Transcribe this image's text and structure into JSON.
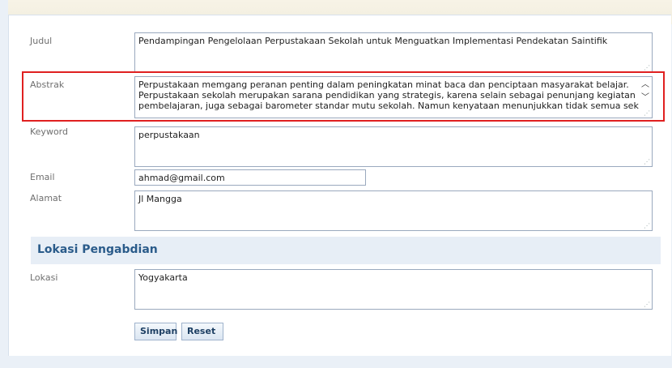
{
  "form": {
    "judul": {
      "label": "Judul",
      "value": "Pendampingan Pengelolaan Perpustakaan Sekolah untuk Menguatkan Implementasi Pendekatan Saintifik"
    },
    "abstrak": {
      "label": "Abstrak",
      "line1": "Perpustakaan memgang peranan penting dalam peningkatan minat baca dan penciptaan masyarakat belajar.",
      "line2": "Perpustakaan sekolah merupakan sarana pendidikan yang strategis, karena selain sebagai penunjang kegiatan",
      "line3": "pembelajaran, juga sebagai barometer standar mutu sekolah. Namun kenyataan menunjukkan tidak semua sekolah,"
    },
    "keyword": {
      "label": "Keyword",
      "value": "perpustakaan"
    },
    "email": {
      "label": "Email",
      "value": "ahmad@gmail.com"
    },
    "alamat": {
      "label": "Alamat",
      "value": "Jl Mangga"
    }
  },
  "lokasi_section": {
    "title": "Lokasi Pengabdian",
    "lokasi": {
      "label": "Lokasi",
      "value": "Yogyakarta"
    }
  },
  "buttons": {
    "simpan": "Simpan",
    "reset": "Reset"
  },
  "icons": {
    "scroll_up": "chevron-up-icon",
    "scroll_down": "chevron-down-icon",
    "resize_grip": "resize-grip-icon"
  },
  "colors": {
    "highlight": "#e02020",
    "section_title": "#2a5b8a"
  }
}
